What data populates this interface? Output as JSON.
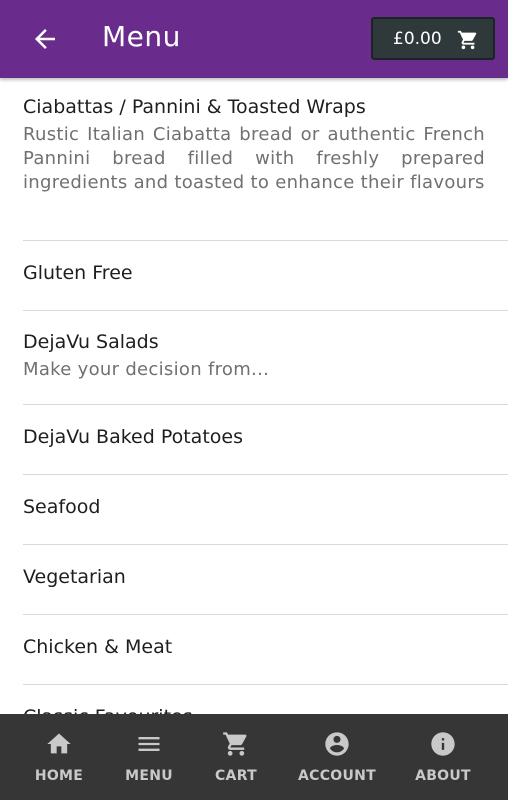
{
  "header": {
    "title": "Menu",
    "back_icon": "arrow-left-icon",
    "cart_total": "£0.00",
    "cart_icon": "shopping-cart-icon",
    "color": "#6a2c8c"
  },
  "menu": {
    "items": [
      {
        "title": "Ciabattas / Pannini & Toasted Wraps",
        "description": "Rustic Italian Ciabatta bread or authentic French Pannini bread filled with freshly prepared ingredients and toasted to enhance their flavours"
      },
      {
        "title": "Gluten Free"
      },
      {
        "title": "DejaVu Salads",
        "description": "Make your decision from..."
      },
      {
        "title": "DejaVu Baked Potatoes"
      },
      {
        "title": "Seafood"
      },
      {
        "title": "Vegetarian"
      },
      {
        "title": "Chicken & Meat"
      },
      {
        "title": "Classic Favourites"
      }
    ]
  },
  "bottom_nav": {
    "items": [
      {
        "label": "HOME",
        "icon": "home-icon"
      },
      {
        "label": "MENU",
        "icon": "menu-icon"
      },
      {
        "label": "CART",
        "icon": "cart-icon"
      },
      {
        "label": "ACCOUNT",
        "icon": "account-icon"
      },
      {
        "label": "ABOUT",
        "icon": "info-icon"
      }
    ]
  }
}
